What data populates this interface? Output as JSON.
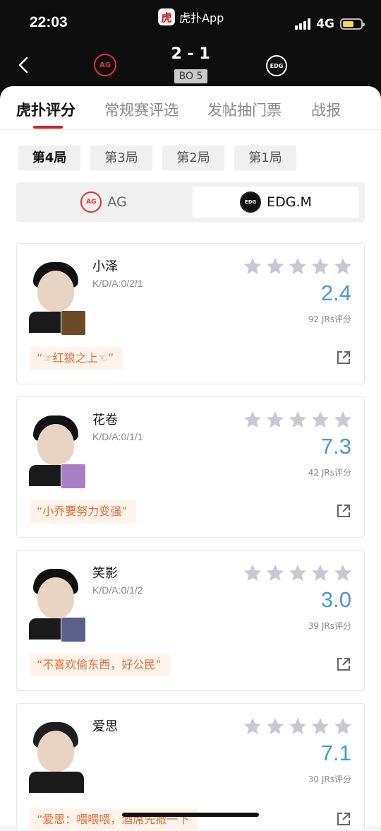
{
  "status_bar": {
    "time": "22:03",
    "network": "4G",
    "battery_level": 0.62
  },
  "app": {
    "logo_char": "虎",
    "name": "虎扑App"
  },
  "match": {
    "score": "2 - 1",
    "format": "BO 5",
    "home_team": "AG",
    "away_team": "EDG.M"
  },
  "tabs": [
    {
      "label": "虎扑评分",
      "active": true
    },
    {
      "label": "常规赛评选",
      "active": false
    },
    {
      "label": "发帖抽门票",
      "active": false
    },
    {
      "label": "战报",
      "active": false
    }
  ],
  "games": [
    {
      "label": "第4局",
      "active": true
    },
    {
      "label": "第3局",
      "active": false
    },
    {
      "label": "第2局",
      "active": false
    },
    {
      "label": "第1局",
      "active": false
    }
  ],
  "team_switch": [
    {
      "label": "AG",
      "active": false
    },
    {
      "label": "EDG.M",
      "active": true
    }
  ],
  "players": [
    {
      "name": "小泽",
      "kda": "K/D/A:0/2/1",
      "rating": "2.4",
      "votes": "92 JRs评分",
      "quote": "“☞红狼之上☜”",
      "hero_color": "#6b4a2a"
    },
    {
      "name": "花卷",
      "kda": "K/D/A:0/1/1",
      "rating": "7.3",
      "votes": "42 JRs评分",
      "quote": "“小乔要努力变强”",
      "hero_color": "#a77fc2"
    },
    {
      "name": "笑影",
      "kda": "K/D/A:0/1/2",
      "rating": "3.0",
      "votes": "39 JRs评分",
      "quote": "“不喜欢偷东西，好公民”",
      "hero_color": "#5b5f8c"
    },
    {
      "name": "爱思",
      "kda": "",
      "rating": "7.1",
      "votes": "30 JRs评分",
      "quote": "“爱思：喂喂喂，酒席先撤一下",
      "hero_color": ""
    }
  ],
  "colors": {
    "accent_red": "#d61f1f",
    "rating_blue": "#4a96d6",
    "quote_orange": "#e06e35",
    "star_gray": "#c8c8d0"
  }
}
